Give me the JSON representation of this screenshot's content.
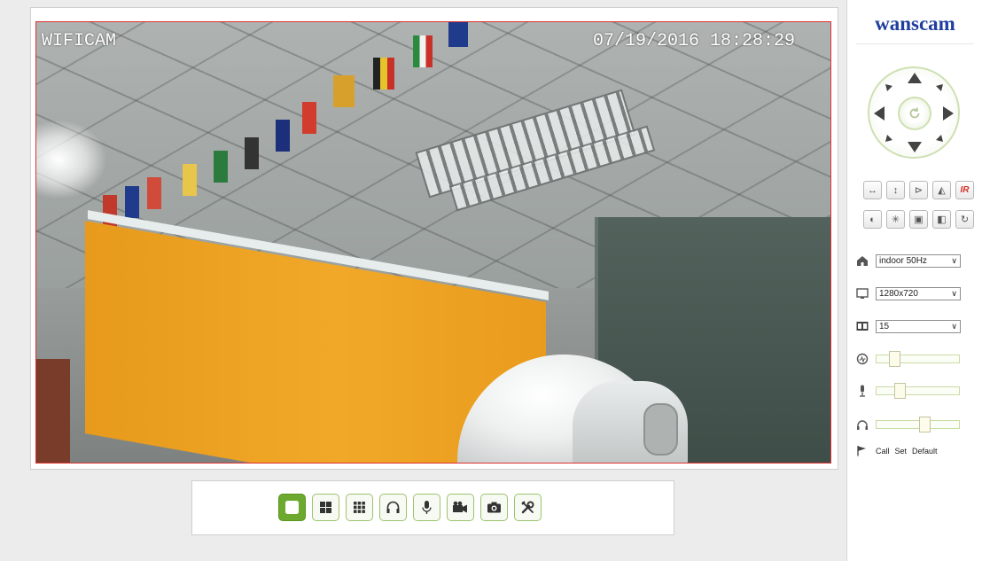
{
  "video": {
    "osd_name": "WIFICAM",
    "osd_datetime": "07/19/2016 18:28:29"
  },
  "toolbar": {
    "buttons": [
      {
        "name": "single-view",
        "icon": "square-icon",
        "active": true
      },
      {
        "name": "four-view",
        "icon": "grid-4-icon"
      },
      {
        "name": "nine-view",
        "icon": "grid-9-icon"
      },
      {
        "name": "audio",
        "icon": "headphones-icon"
      },
      {
        "name": "talk",
        "icon": "microphone-icon"
      },
      {
        "name": "record",
        "icon": "video-camera-icon"
      },
      {
        "name": "snapshot",
        "icon": "camera-icon"
      },
      {
        "name": "settings",
        "icon": "tools-icon"
      }
    ]
  },
  "sidebar": {
    "brand": "wanscam",
    "image_controls": {
      "ir_label": "IR"
    },
    "mode": {
      "value": "indoor 50Hz"
    },
    "resolution": {
      "value": "1280x720"
    },
    "fps": {
      "value": "15"
    },
    "preset": {
      "call_label": "Call",
      "set_label": "Set",
      "default_label": "Default"
    },
    "sliders": {
      "brightness_level": 0.18,
      "mic_level": 0.25,
      "volume_level": 0.6
    }
  },
  "colors": {
    "accent_green": "#6ca92e",
    "brand_blue": "#1f3e9e",
    "ir_red": "#d6322a"
  }
}
